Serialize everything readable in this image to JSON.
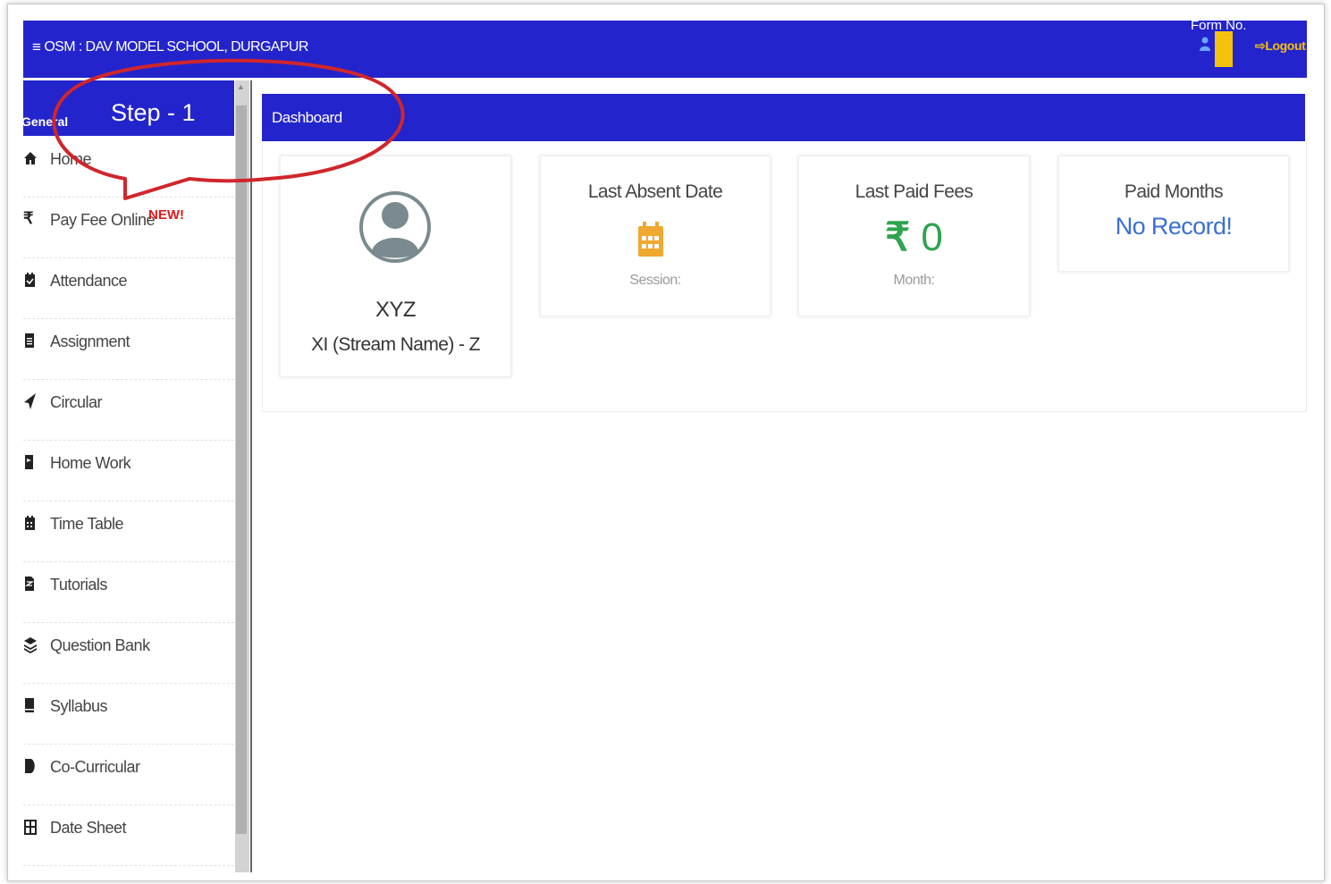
{
  "topbar": {
    "title": "OSM : DAV MODEL SCHOOL, DURGAPUR",
    "form_no_label": "Form No.",
    "logout_label": "Logout"
  },
  "sidebar": {
    "section_label": "General",
    "step_label": "Step - 1",
    "items": [
      {
        "label": "Home",
        "icon": "home-icon"
      },
      {
        "label": "Pay Fee Online",
        "icon": "rupee-icon",
        "badge": "NEW!"
      },
      {
        "label": "Attendance",
        "icon": "calendar-check-icon"
      },
      {
        "label": "Assignment",
        "icon": "file-text-icon"
      },
      {
        "label": "Circular",
        "icon": "paper-plane-icon"
      },
      {
        "label": "Home Work",
        "icon": "book-icon"
      },
      {
        "label": "Time Table",
        "icon": "calendar-icon"
      },
      {
        "label": "Tutorials",
        "icon": "file-icon"
      },
      {
        "label": "Question Bank",
        "icon": "stack-icon"
      },
      {
        "label": "Syllabus",
        "icon": "book-open-icon"
      },
      {
        "label": "Co-Curricular",
        "icon": "palette-icon"
      },
      {
        "label": "Date Sheet",
        "icon": "table-icon"
      }
    ]
  },
  "dashboard": {
    "title": "Dashboard",
    "profile": {
      "name": "XYZ",
      "class": "XI (Stream Name) - Z"
    },
    "cards": {
      "absent": {
        "title": "Last Absent Date",
        "sub": "Session:"
      },
      "fees": {
        "title": "Last Paid Fees",
        "currency": "₹",
        "value": "0",
        "sub": "Month:"
      },
      "months": {
        "title": "Paid Months",
        "value": "No Record!"
      }
    }
  },
  "colors": {
    "primary": "#2424cc",
    "accent_yellow": "#f4c20d",
    "fees_green": "#2ea44f",
    "calendar_orange": "#f0a830",
    "annotation_red": "#d0262c"
  }
}
